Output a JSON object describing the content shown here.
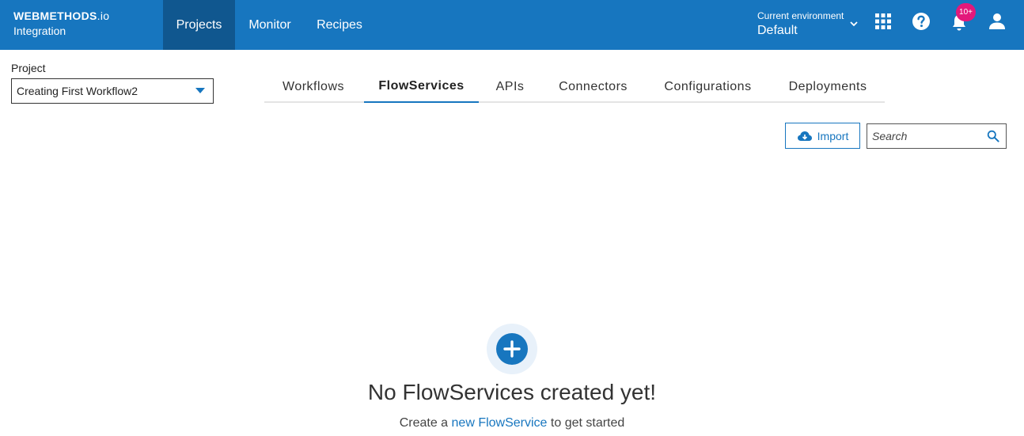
{
  "brand": {
    "name": "WEBMETHODS",
    "suffix": ".io",
    "product": "Integration"
  },
  "nav": [
    {
      "label": "Projects",
      "active": true
    },
    {
      "label": "Monitor",
      "active": false
    },
    {
      "label": "Recipes",
      "active": false
    }
  ],
  "environment": {
    "label": "Current environment",
    "value": "Default"
  },
  "header_icons": [
    "apps-grid-icon",
    "help-icon",
    "bell-icon",
    "user-icon"
  ],
  "notifications": {
    "badge": "10+"
  },
  "project": {
    "label": "Project",
    "selected": "Creating First Workflow2"
  },
  "tabs": [
    {
      "label": "Workflows",
      "active": false
    },
    {
      "label": "FlowServices",
      "active": true
    },
    {
      "label": "APIs",
      "active": false
    },
    {
      "label": "Connectors",
      "active": false
    },
    {
      "label": "Configurations",
      "active": false
    },
    {
      "label": "Deployments",
      "active": false
    }
  ],
  "toolbar": {
    "import_label": "Import",
    "search_placeholder": "Search"
  },
  "empty_state": {
    "title": "No FlowServices created yet!",
    "sub_prefix": "Create a ",
    "sub_link": "new FlowService",
    "sub_suffix": " to get started"
  },
  "colors": {
    "brand_blue": "#1776bf",
    "nav_active": "#10578f",
    "badge_pink": "#e3197b"
  }
}
